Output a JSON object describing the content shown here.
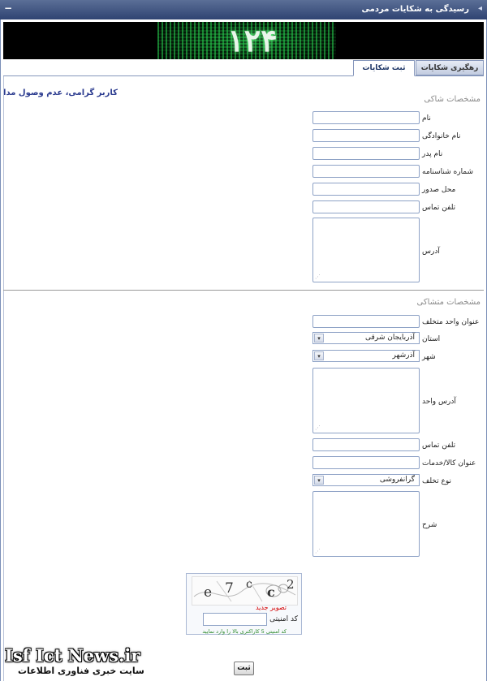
{
  "window": {
    "title": "رسیدگی به شکایات مردمی",
    "minimize_label": "−"
  },
  "banner": {
    "number": "۱۲۴"
  },
  "tabs": [
    {
      "label": "رهگیری شکایات"
    },
    {
      "label": "ثبت شکایات"
    }
  ],
  "notice": "کاربر گرامی، عدم وصول مدارک ا",
  "complainant": {
    "title": "مشخصات شاکی",
    "fields": {
      "name": "نام",
      "family": "نام خانوادگی",
      "father": "نام پدر",
      "id_number": "شماره شناسنامه",
      "issue_place": "محل صدور",
      "phone": "تلفن تماس",
      "address": "آدرس"
    }
  },
  "defendant": {
    "title": "مشخصات متشاکی",
    "fields": {
      "unit_title": "عنوان واحد متخلف",
      "province": "استان",
      "city": "شهر",
      "unit_address": "آدرس واحد",
      "phone": "تلفن تماس",
      "goods_title": "عنوان کالا/خدمات",
      "violation_type": "نوع تخلف",
      "description": "شرح"
    },
    "selects": {
      "province": "آذربایجان شرقی",
      "city": "آذرشهر",
      "violation_type": "گرانفروشی"
    }
  },
  "captcha": {
    "chars": [
      "e",
      "7",
      "c",
      "c",
      "2"
    ],
    "new_image": "تصویر جدید",
    "label": "کد امنیتی",
    "hint": "کد امنیتی 5 کاراکتری بالا را وارد نمایید"
  },
  "submit_label": "ثبت",
  "watermark": {
    "brand": "Isf Ict News.ir",
    "subtitle": "سایت خبری فناوری اطلاعات"
  }
}
